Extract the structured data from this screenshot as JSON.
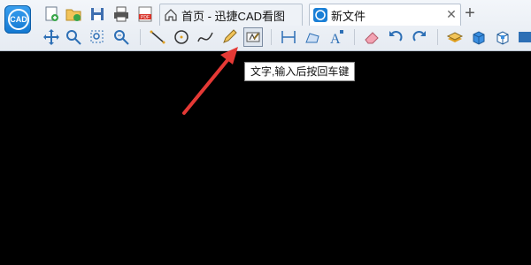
{
  "app": {
    "logo_text": "CAD",
    "tabs": [
      {
        "label": "首页 - 迅捷CAD看图",
        "icon": "home-icon",
        "active": false
      },
      {
        "label": "新文件",
        "icon": "cad-file-icon",
        "active": true
      }
    ],
    "close_tab_symbol": "✕",
    "new_tab_symbol": "+"
  },
  "quick_access": [
    "new-file-icon",
    "open-folder-icon",
    "save-icon",
    "print-icon",
    "pdf-icon"
  ],
  "toolbar": {
    "groups": [
      [
        "pan-icon",
        "zoom-icon",
        "zoom-window-icon",
        "zoom-extents-icon"
      ],
      [
        "line-icon",
        "circle-icon",
        "spline-icon",
        "pencil-icon",
        "text-tool-icon"
      ],
      [
        "measure-icon",
        "area-icon",
        "text-style-icon"
      ],
      [
        "eraser-icon",
        "undo-icon",
        "redo-icon"
      ],
      [
        "layer-icon",
        "3d-box-icon",
        "3d-view-icon"
      ]
    ],
    "active_tool": "text-tool-icon"
  },
  "tooltip": {
    "text": "文字,输入后按回车键"
  },
  "colors": {
    "canvas": "#000000",
    "accent": "#1a7fd6",
    "annotation_arrow": "#e53935"
  }
}
